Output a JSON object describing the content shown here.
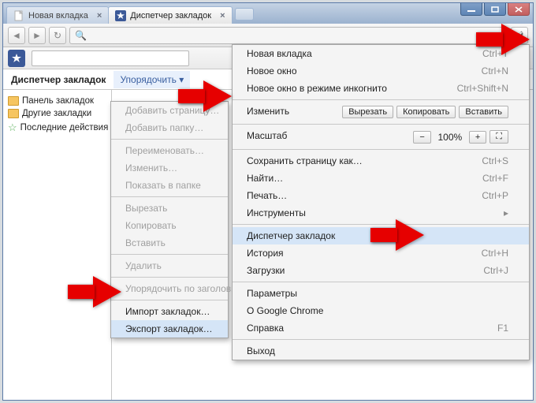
{
  "tabs": {
    "inactive_label": "Новая вкладка",
    "active_label": "Диспетчер закладок"
  },
  "bookmark_manager": {
    "title": "Диспетчер закладок",
    "organize_label": "Упорядочить",
    "tree": {
      "bar": "Панель закладок",
      "other": "Другие закладки",
      "recent": "Последние действия"
    }
  },
  "organize_menu": {
    "add_page": "Добавить страницу…",
    "add_folder": "Добавить папку…",
    "rename": "Переименовать…",
    "edit": "Изменить…",
    "show_in_folder": "Показать в папке",
    "cut": "Вырезать",
    "copy": "Копировать",
    "paste": "Вставить",
    "delete": "Удалить",
    "sort": "Упорядочить по заголовкам",
    "import": "Импорт закладок…",
    "export": "Экспорт закладок…"
  },
  "wrench_menu": {
    "new_tab": {
      "label": "Новая вкладка",
      "shortcut": "Ctrl+T"
    },
    "new_window": {
      "label": "Новое окно",
      "shortcut": "Ctrl+N"
    },
    "incognito": {
      "label": "Новое окно в режиме инкогнито",
      "shortcut": "Ctrl+Shift+N"
    },
    "edit_label": "Изменить",
    "edit_cut": "Вырезать",
    "edit_copy": "Копировать",
    "edit_paste": "Вставить",
    "zoom_label": "Масштаб",
    "zoom_value": "100%",
    "save_as": {
      "label": "Сохранить страницу как…",
      "shortcut": "Ctrl+S"
    },
    "find": {
      "label": "Найти…",
      "shortcut": "Ctrl+F"
    },
    "print": {
      "label": "Печать…",
      "shortcut": "Ctrl+P"
    },
    "tools": "Инструменты",
    "bookmark_mgr": "Диспетчер закладок",
    "history": {
      "label": "История",
      "shortcut": "Ctrl+H"
    },
    "downloads": {
      "label": "Загрузки",
      "shortcut": "Ctrl+J"
    },
    "settings": "Параметры",
    "about": "О Google Chrome",
    "help": {
      "label": "Справка",
      "shortcut": "F1"
    },
    "exit": "Выход"
  }
}
